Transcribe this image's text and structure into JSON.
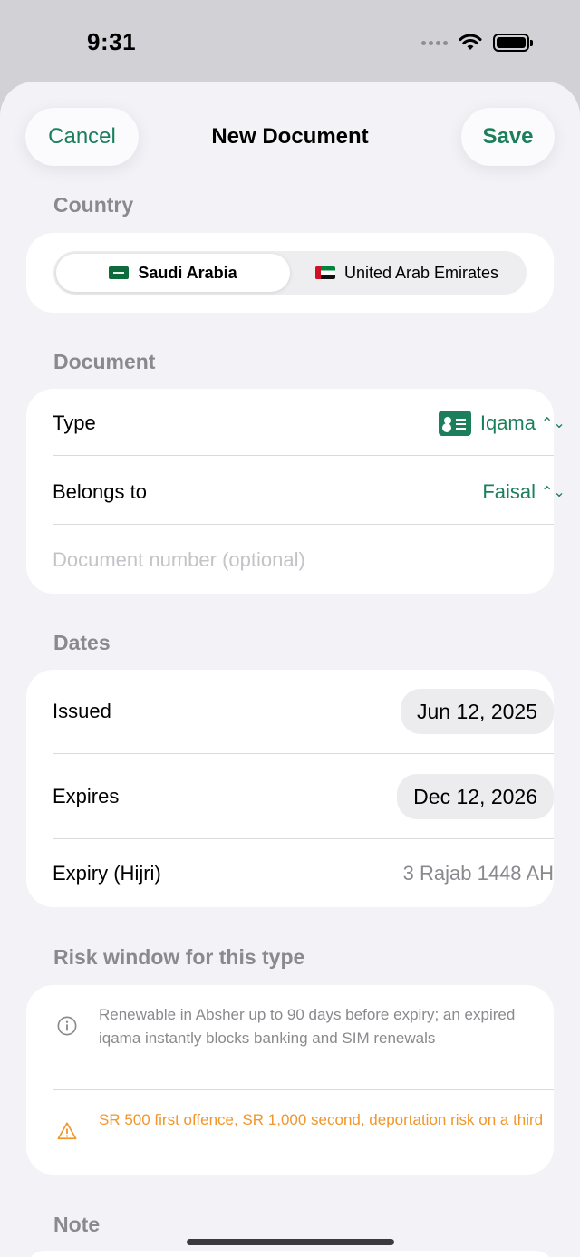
{
  "status_bar": {
    "time": "9:31"
  },
  "nav": {
    "cancel_label": "Cancel",
    "title": "New Document",
    "save_label": "Save"
  },
  "country": {
    "header": "Country",
    "options": [
      {
        "label": "Saudi Arabia",
        "selected": true
      },
      {
        "label": "United Arab Emirates",
        "selected": false
      }
    ]
  },
  "document": {
    "header": "Document",
    "type_label": "Type",
    "type_value": "Iqama",
    "belongs_label": "Belongs to",
    "belongs_value": "Faisal",
    "number_placeholder": "Document number (optional)"
  },
  "dates": {
    "header": "Dates",
    "issued_label": "Issued",
    "issued_value": "Jun 12, 2025",
    "expires_label": "Expires",
    "expires_value": "Dec 12, 2026",
    "hijri_label": "Expiry (Hijri)",
    "hijri_value": "3 Rajab 1448 AH"
  },
  "risk": {
    "header": "Risk window for this type",
    "info_text": "Renewable in Absher up to 90 days before expiry; an expired iqama instantly blocks banking and SIM renewals",
    "warning_text": "SR 500 first offence, SR 1,000 second, deportation risk on a third"
  },
  "note": {
    "header": "Note"
  },
  "colors": {
    "accent": "#1a7f5a",
    "warning": "#f0962b",
    "secondary_text": "#8a8a8e"
  }
}
